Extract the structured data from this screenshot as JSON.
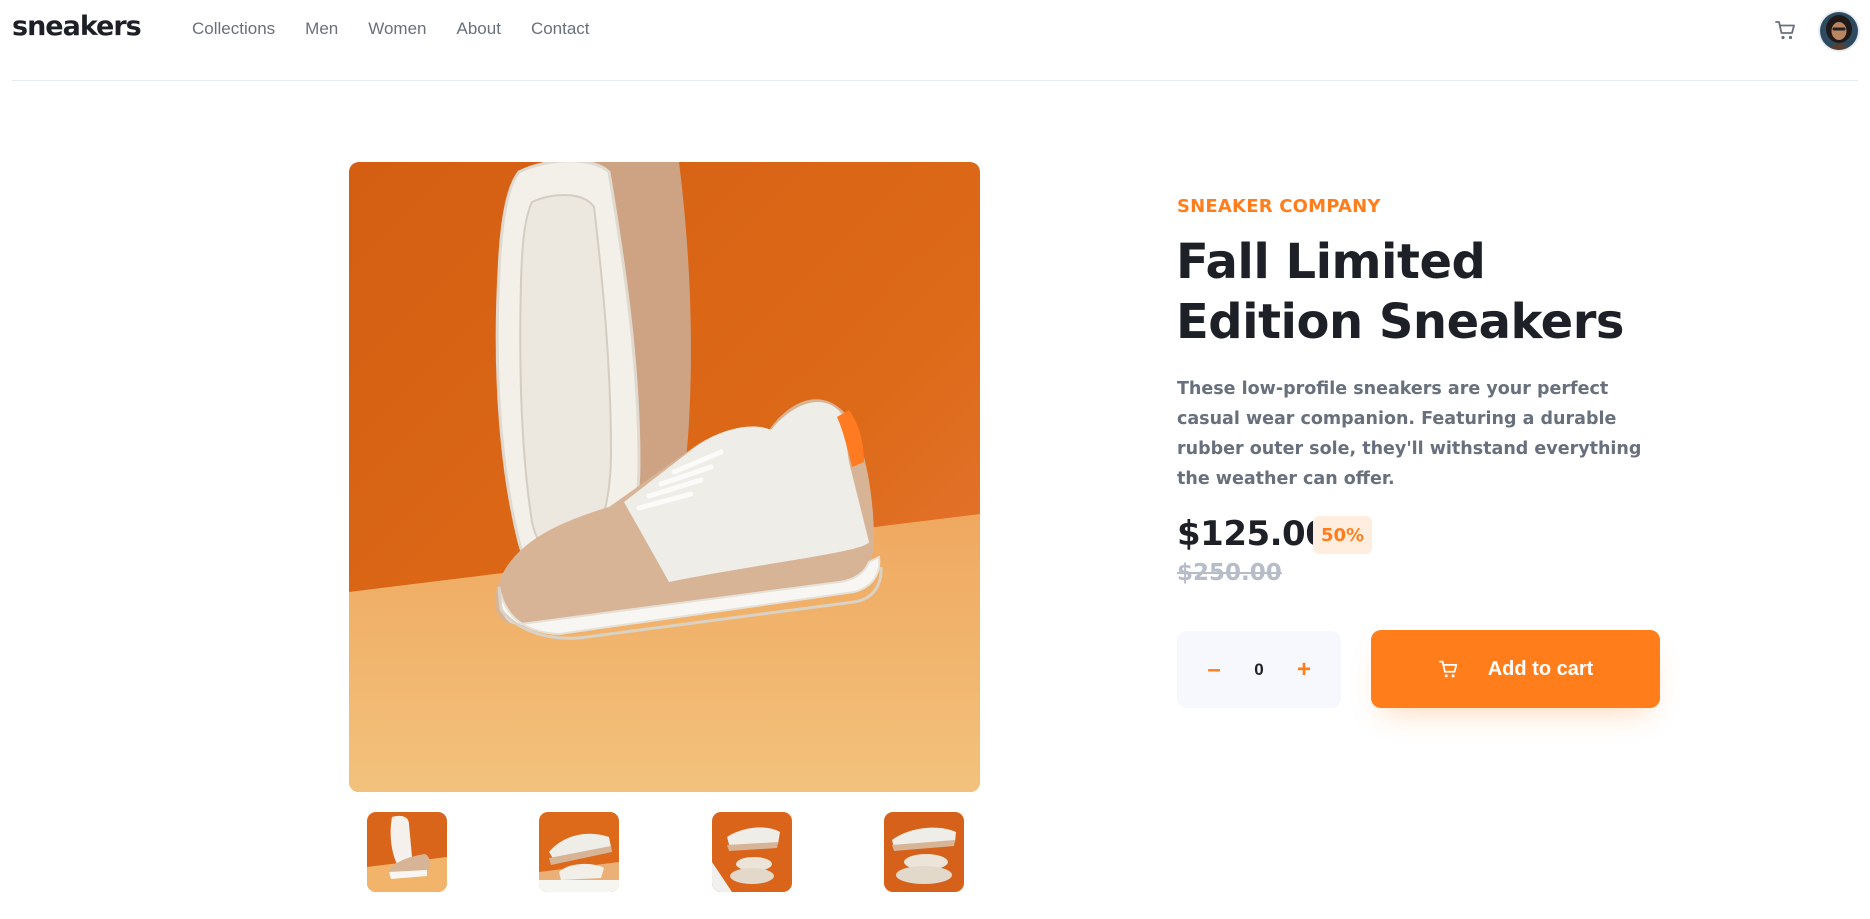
{
  "header": {
    "logo": "sneakers",
    "nav": [
      "Collections",
      "Men",
      "Women",
      "About",
      "Contact"
    ],
    "cart_icon": "cart-icon",
    "avatar_icon": "avatar-image"
  },
  "gallery": {
    "main_image": "product-image-1",
    "thumbnails": [
      "product-thumbnail-1",
      "product-thumbnail-2",
      "product-thumbnail-3",
      "product-thumbnail-4"
    ]
  },
  "product": {
    "company": "SNEAKER COMPANY",
    "title": "Fall Limited Edition Sneakers",
    "description": "These low-profile sneakers are your perfect casual wear companion. Featuring a durable rubber outer sole, they'll withstand everything the weather can offer.",
    "price": "$125.00",
    "discount": "50%",
    "original_price": "$250.00"
  },
  "quantity": {
    "minus": "–",
    "value": "0",
    "plus": "+"
  },
  "add_to_cart": {
    "label": "Add to cart",
    "icon": "cart-icon"
  },
  "colors": {
    "accent": "#ff7e1b",
    "accent_pale": "#ffede0",
    "dark": "#1d2026",
    "grey": "#68707d",
    "light_grey": "#b6bcc8"
  }
}
